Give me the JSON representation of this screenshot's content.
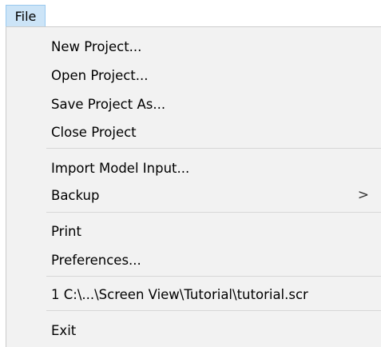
{
  "menubar": {
    "file_label": "File"
  },
  "menu": {
    "items": [
      {
        "label": "New Project..."
      },
      {
        "label": "Open Project..."
      },
      {
        "label": "Save Project As..."
      },
      {
        "label": "Close Project"
      },
      {
        "label": "Import Model Input..."
      },
      {
        "label": "Backup",
        "submenu_arrow": ">"
      },
      {
        "label": "Print"
      },
      {
        "label": "Preferences..."
      },
      {
        "label": "1 C:\\...\\Screen View\\Tutorial\\tutorial.scr"
      },
      {
        "label": "Exit"
      }
    ]
  },
  "colors": {
    "menubar_highlight": "#cce4f7",
    "menubar_highlight_border": "#99c9ef",
    "menu_background": "#f2f2f2",
    "separator": "#d7d7d7"
  },
  "icons": {
    "submenu_arrow": "chevron-right-icon"
  }
}
